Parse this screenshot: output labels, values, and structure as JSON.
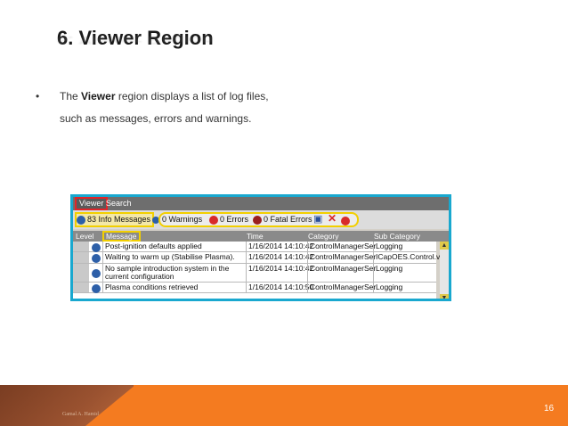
{
  "slide": {
    "title": "6. Viewer Region",
    "bullet": "•",
    "line1_prefix": "The ",
    "line1_bold": "Viewer",
    "line1_suffix": " region displays a list of log files,",
    "line2": "such as messages, errors and warnings.",
    "author": "Gamal A. Hamid",
    "page_number": "16"
  },
  "viewer": {
    "tabs": [
      "Viewer",
      "Search"
    ],
    "toolbar": {
      "info": "83 Info Messages",
      "warnings": "0 Warnings",
      "errors": "0 Errors",
      "fatal": "0 Fatal Errors"
    },
    "columns": [
      "Level",
      "Message",
      "Time",
      "Category",
      "Sub Category"
    ],
    "rows": [
      {
        "message": "Post-ignition defaults applied",
        "time": "1/16/2014 14:10:42",
        "category": "ControlManagerSer",
        "subcategory": "Logging"
      },
      {
        "message": "Waiting to warm up (Stabilise Plasma).",
        "time": "1/16/2014 14:10:42",
        "category": "ControlManagerSer",
        "subcategory": "ICapOES.Control.vi"
      },
      {
        "message": "No sample introduction system in the current configuration",
        "time": "1/16/2014 14:10:42",
        "category": "ControlManagerSer",
        "subcategory": "Logging"
      },
      {
        "message": "Plasma conditions retrieved",
        "time": "1/16/2014 14:10:50",
        "category": "ControlManagerSer",
        "subcategory": "Logging"
      }
    ]
  },
  "colors": {
    "accent_orange": "#f47b20",
    "panel_border": "#19a8cf",
    "highlight_yellow": "#f2cf00",
    "highlight_red": "#e0252a"
  }
}
